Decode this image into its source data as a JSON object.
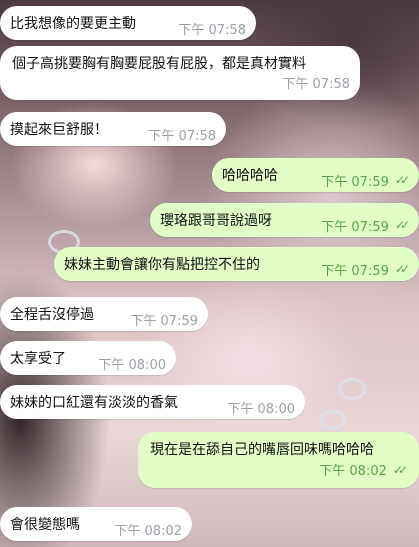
{
  "messages": [
    {
      "side": "in",
      "text": "比我想像的要更主動",
      "time": "下午 07:58"
    },
    {
      "side": "in",
      "text": "個子高挑要胸有胸要屁股有屁股，都是真材實料",
      "time": "下午 07:58"
    },
    {
      "side": "in",
      "text": "摸起來巨舒服！",
      "time": "下午 07:58"
    },
    {
      "side": "out",
      "text": "哈哈哈哈",
      "time": "下午 07:59",
      "status": "read"
    },
    {
      "side": "out",
      "text": "瓔珞跟哥哥說過呀",
      "time": "下午 07:59",
      "status": "read"
    },
    {
      "side": "out",
      "text": "妹妹主動會讓你有點把控不住的",
      "time": "下午 07:59",
      "status": "read"
    },
    {
      "side": "in",
      "text": "全程舌沒停過",
      "time": "下午 07:59"
    },
    {
      "side": "in",
      "text": "太享受了",
      "time": "下午 08:00"
    },
    {
      "side": "in",
      "text": "妹妹的口紅還有淡淡的香氣",
      "time": "下午 08:00"
    },
    {
      "side": "out",
      "text": "現在是在舔自己的嘴唇回味嗎哈哈哈",
      "time": "下午 08:02",
      "status": "read"
    },
    {
      "side": "in",
      "text": "會很變態嗎",
      "time": "下午 08:02"
    }
  ],
  "icons": {
    "read_receipt": "double-check-icon"
  },
  "colors": {
    "incoming": "#ffffff",
    "outgoing": "#e1fec6",
    "time_in": "#9aa0a6",
    "time_out": "#5aa34a"
  }
}
